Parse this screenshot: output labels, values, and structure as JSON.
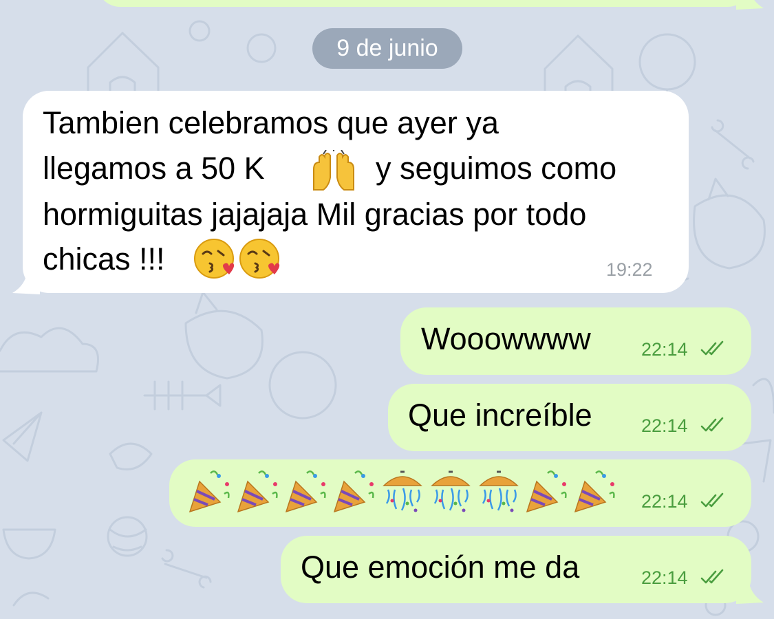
{
  "date_separator": "9 de junio",
  "messages": [
    {
      "direction": "incoming",
      "lines": [
        "Tambien celebramos que ayer ya",
        "llegamos a 50 K",
        "y seguimos como",
        "hormiguitas jajajaja Mil gracias por todo",
        "chicas !!!"
      ],
      "emoji": [
        "raising-hands",
        "kissing-face-with-heart",
        "kissing-face-with-heart"
      ],
      "time": "19:22"
    },
    {
      "direction": "outgoing",
      "text": "Wooowwww",
      "time": "22:14",
      "status": "read-double-check"
    },
    {
      "direction": "outgoing",
      "text": "Que increíble",
      "time": "22:14",
      "status": "read-double-check"
    },
    {
      "direction": "outgoing",
      "emoji": [
        "party-popper",
        "party-popper",
        "party-popper",
        "party-popper",
        "confetti-ball",
        "confetti-ball",
        "confetti-ball",
        "party-popper",
        "party-popper"
      ],
      "time": "22:14",
      "status": "read-double-check"
    },
    {
      "direction": "outgoing",
      "text": "Que emoción me da",
      "time": "22:14",
      "status": "read-double-check"
    }
  ],
  "colors": {
    "background": "#d6deea",
    "incoming_bubble": "#ffffff",
    "outgoing_bubble": "#e2fcc4",
    "outgoing_time": "#4a9d3f",
    "incoming_time": "#9aa0a6",
    "date_pill": "#8b99aa"
  }
}
